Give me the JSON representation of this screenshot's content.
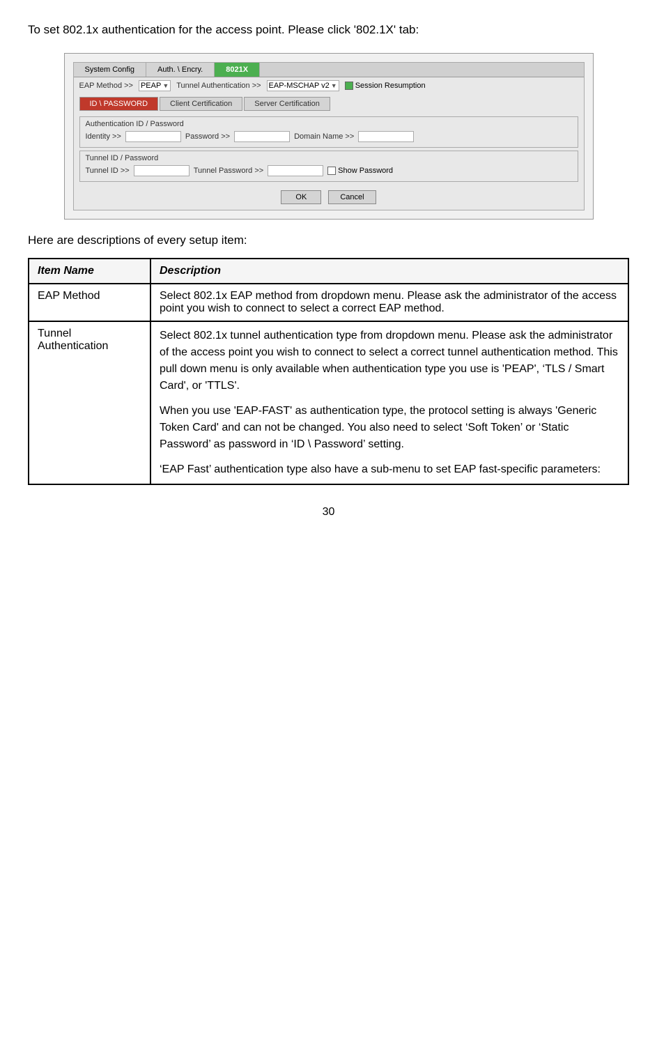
{
  "intro": {
    "text": "To set 802.1x authentication for the access point. Please click '802.1X' tab:"
  },
  "screenshot": {
    "tabs": [
      {
        "label": "System Config",
        "active": false
      },
      {
        "label": "Auth. \\ Encry.",
        "active": false
      },
      {
        "label": "8021X",
        "active": true
      }
    ],
    "top_row": {
      "eap_method_label": "EAP Method >>",
      "eap_method_value": "PEAP",
      "tunnel_auth_label": "Tunnel Authentication >>",
      "tunnel_auth_value": "EAP-MSCHAP v2",
      "session_resumption_label": "Session Resumption"
    },
    "content_tabs": [
      {
        "label": "ID \\ PASSWORD",
        "active": true
      },
      {
        "label": "Client Certification",
        "active": false
      },
      {
        "label": "Server Certification",
        "active": false
      }
    ],
    "auth_section": {
      "title": "Authentication ID / Password",
      "identity_label": "Identity >>",
      "password_label": "Password >>",
      "domain_label": "Domain Name >>"
    },
    "tunnel_section": {
      "title": "Tunnel ID / Password",
      "tunnel_id_label": "Tunnel ID >>",
      "tunnel_password_label": "Tunnel Password >>",
      "show_password_label": "Show Password"
    },
    "buttons": {
      "ok": "OK",
      "cancel": "Cancel"
    }
  },
  "here_text": "Here are descriptions of every setup item:",
  "table": {
    "headers": [
      "Item Name",
      "Description"
    ],
    "rows": [
      {
        "name": "EAP Method",
        "description": "Select 802.1x EAP method from dropdown menu. Please ask the administrator of the access point you wish to connect to select a correct EAP method."
      },
      {
        "name": "Tunnel\nAuthentication",
        "desc_parts": [
          "Select 802.1x tunnel authentication type from dropdown menu. Please ask the administrator of the access point you wish to connect to select a correct tunnel authentication method. This pull down menu is only available when authentication type you use is 'PEAP', ‘TLS / Smart Card', or 'TTLS'.",
          "When you use 'EAP-FAST' as authentication type, the protocol setting is always 'Generic Token Card' and can not be changed. You also need to select ‘Soft Token’ or ‘Static Password’ as password in ‘ID \\ Password’ setting.",
          "‘EAP Fast’ authentication type also have a sub-menu to set EAP fast-specific parameters:"
        ]
      }
    ]
  },
  "page_number": "30"
}
